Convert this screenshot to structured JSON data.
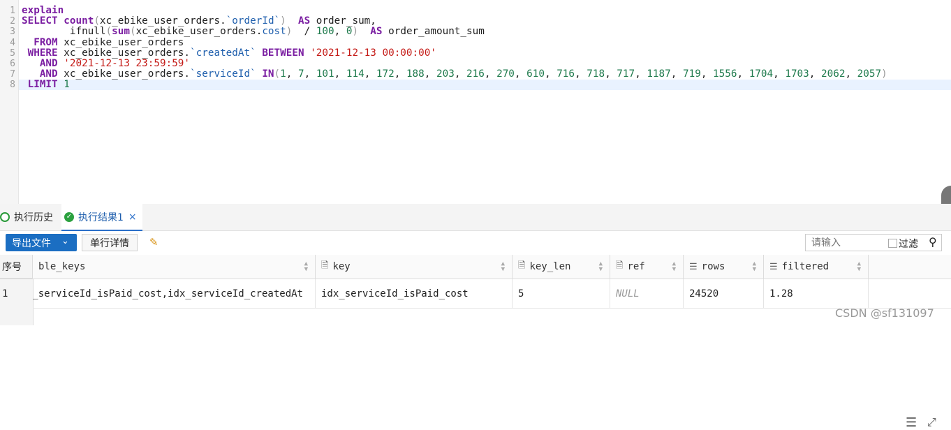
{
  "editor": {
    "line_numbers": [
      "1",
      "2",
      "3",
      "4",
      "5",
      "6",
      "7",
      "8"
    ],
    "lines": [
      [
        {
          "t": "explain",
          "c": "kw"
        }
      ],
      [
        {
          "t": "SELECT ",
          "c": "kw"
        },
        {
          "t": "count",
          "c": "fn"
        },
        {
          "t": "(",
          "c": "gray"
        },
        {
          "t": "xc_ebike_user_orders.",
          "c": ""
        },
        {
          "t": "`orderId`",
          "c": "qid"
        },
        {
          "t": ")  ",
          "c": "gray"
        },
        {
          "t": "AS",
          "c": "kw"
        },
        {
          "t": " order_sum,",
          "c": ""
        }
      ],
      [
        {
          "t": "        ifnull",
          "c": ""
        },
        {
          "t": "(",
          "c": "gray"
        },
        {
          "t": "sum",
          "c": "fn"
        },
        {
          "t": "(",
          "c": "gray"
        },
        {
          "t": "xc_ebike_user_orders.",
          "c": ""
        },
        {
          "t": "cost",
          "c": "qid"
        },
        {
          "t": ")  ",
          "c": "gray"
        },
        {
          "t": "/ ",
          "c": ""
        },
        {
          "t": "100",
          "c": "num"
        },
        {
          "t": ", ",
          "c": ""
        },
        {
          "t": "0",
          "c": "num"
        },
        {
          "t": ")  ",
          "c": "gray"
        },
        {
          "t": "AS",
          "c": "kw"
        },
        {
          "t": " order_amount_sum",
          "c": ""
        }
      ],
      [
        {
          "t": "  FROM ",
          "c": "kw"
        },
        {
          "t": "xc_ebike_user_orders",
          "c": ""
        }
      ],
      [
        {
          "t": " WHERE ",
          "c": "kw"
        },
        {
          "t": "xc_ebike_user_orders.",
          "c": ""
        },
        {
          "t": "`createdAt`",
          "c": "qid"
        },
        {
          "t": " BETWEEN ",
          "c": "kw"
        },
        {
          "t": "'2021-12-13 00:00:00'",
          "c": "str"
        }
      ],
      [
        {
          "t": "   AND ",
          "c": "kw"
        },
        {
          "t": "'2021-12-13 23:59:59'",
          "c": "str"
        }
      ],
      [
        {
          "t": "   AND ",
          "c": "kw"
        },
        {
          "t": "xc_ebike_user_orders.",
          "c": ""
        },
        {
          "t": "`serviceId`",
          "c": "qid"
        },
        {
          "t": " IN",
          "c": "kw"
        },
        {
          "t": "(",
          "c": "gray"
        },
        {
          "t": "1",
          "c": "num"
        },
        {
          "t": ", ",
          "c": ""
        },
        {
          "t": "7",
          "c": "num"
        },
        {
          "t": ", ",
          "c": ""
        },
        {
          "t": "101",
          "c": "num"
        },
        {
          "t": ", ",
          "c": ""
        },
        {
          "t": "114",
          "c": "num"
        },
        {
          "t": ", ",
          "c": ""
        },
        {
          "t": "172",
          "c": "num"
        },
        {
          "t": ", ",
          "c": ""
        },
        {
          "t": "188",
          "c": "num"
        },
        {
          "t": ", ",
          "c": ""
        },
        {
          "t": "203",
          "c": "num"
        },
        {
          "t": ", ",
          "c": ""
        },
        {
          "t": "216",
          "c": "num"
        },
        {
          "t": ", ",
          "c": ""
        },
        {
          "t": "270",
          "c": "num"
        },
        {
          "t": ", ",
          "c": ""
        },
        {
          "t": "610",
          "c": "num"
        },
        {
          "t": ", ",
          "c": ""
        },
        {
          "t": "716",
          "c": "num"
        },
        {
          "t": ", ",
          "c": ""
        },
        {
          "t": "718",
          "c": "num"
        },
        {
          "t": ", ",
          "c": ""
        },
        {
          "t": "717",
          "c": "num"
        },
        {
          "t": ", ",
          "c": ""
        },
        {
          "t": "1187",
          "c": "num"
        },
        {
          "t": ", ",
          "c": ""
        },
        {
          "t": "719",
          "c": "num"
        },
        {
          "t": ", ",
          "c": ""
        },
        {
          "t": "1556",
          "c": "num"
        },
        {
          "t": ", ",
          "c": ""
        },
        {
          "t": "1704",
          "c": "num"
        },
        {
          "t": ", ",
          "c": ""
        },
        {
          "t": "1703",
          "c": "num"
        },
        {
          "t": ", ",
          "c": ""
        },
        {
          "t": "2062",
          "c": "num"
        },
        {
          "t": ", ",
          "c": ""
        },
        {
          "t": "2057",
          "c": "num"
        },
        {
          "t": ")",
          "c": "gray"
        }
      ],
      [
        {
          "t": " LIMIT ",
          "c": "kw"
        },
        {
          "t": "1",
          "c": "num"
        }
      ]
    ]
  },
  "tabs": {
    "history_label": "执行历史",
    "result_label": "执行结果1",
    "result_close": "×"
  },
  "toolbar": {
    "export_label": "导出文件",
    "detail_label": "单行详情",
    "search_placeholder": "请输入",
    "filter_label": "过滤"
  },
  "grid": {
    "rownum_header": "序号",
    "columns": [
      {
        "label": "ble_keys",
        "icon": ""
      },
      {
        "label": "key",
        "icon": "text-column-icon"
      },
      {
        "label": "key_len",
        "icon": "text-column-icon"
      },
      {
        "label": "ref",
        "icon": "text-column-icon"
      },
      {
        "label": "rows",
        "icon": "list-column-icon"
      },
      {
        "label": "filtered",
        "icon": "list-column-icon"
      }
    ],
    "rows": [
      {
        "num": "1",
        "cells": [
          "t,idx_serviceId_isPaid_cost,idx_serviceId_createdAt",
          "idx_serviceId_isPaid_cost",
          "5",
          "NULL",
          "24520",
          "1.28"
        ]
      }
    ]
  },
  "watermark": "CSDN @sf131097",
  "colors": {
    "accent": "#1b6ec2",
    "keyword": "#7b1fa2",
    "string": "#c41a16",
    "number": "#1e7a4c"
  }
}
